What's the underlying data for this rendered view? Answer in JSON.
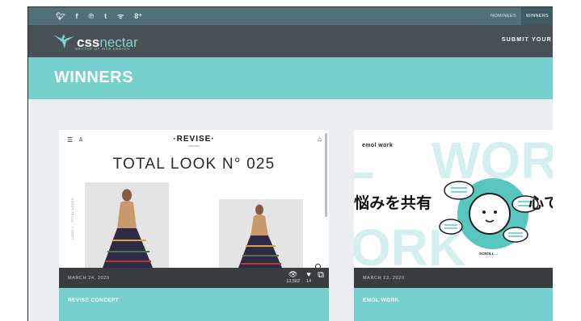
{
  "topbar": {
    "social_icons": [
      {
        "name": "twitter-icon",
        "glyph": "🐦︎"
      },
      {
        "name": "facebook-icon",
        "glyph": "f"
      },
      {
        "name": "pinterest-icon",
        "glyph": "℗"
      },
      {
        "name": "tumblr-icon",
        "glyph": "t"
      },
      {
        "name": "rss-icon",
        "glyph": "ᯤ"
      },
      {
        "name": "google-plus-icon",
        "glyph": "8⁺"
      }
    ],
    "nav": {
      "nominees": "NOMINEES",
      "winners": "WINNERS"
    }
  },
  "header": {
    "logo_css": "css",
    "logo_nectar": "nectar",
    "tagline": "NECTAR OF WEB DESIGN",
    "submit": "SUBMIT YOUR"
  },
  "banner": {
    "title": "WINNERS"
  },
  "colors": {
    "teal": "#75d0ce",
    "dark_header": "#4a5155",
    "topbar": "#52707a",
    "card_footer": "#3a3d40"
  },
  "cards": [
    {
      "date": "MARCH 24, 2020",
      "title": "REVISE CONCEPT",
      "views": "13,502",
      "likes": "14",
      "preview": {
        "brand": "·REVISE·",
        "brand_sub": "CONCEPT",
        "headline": "TOTAL LOOK N° 025",
        "vertical_text": "LOOK 1 · TOTAL LOOKS"
      }
    },
    {
      "date": "MARCH 23, 2020",
      "title": "EMOL WORK",
      "preview": {
        "logo": "emol work",
        "jp_left": "悩みを共有",
        "jp_right": "心て",
        "scroll": "SCROLL →"
      }
    }
  ]
}
